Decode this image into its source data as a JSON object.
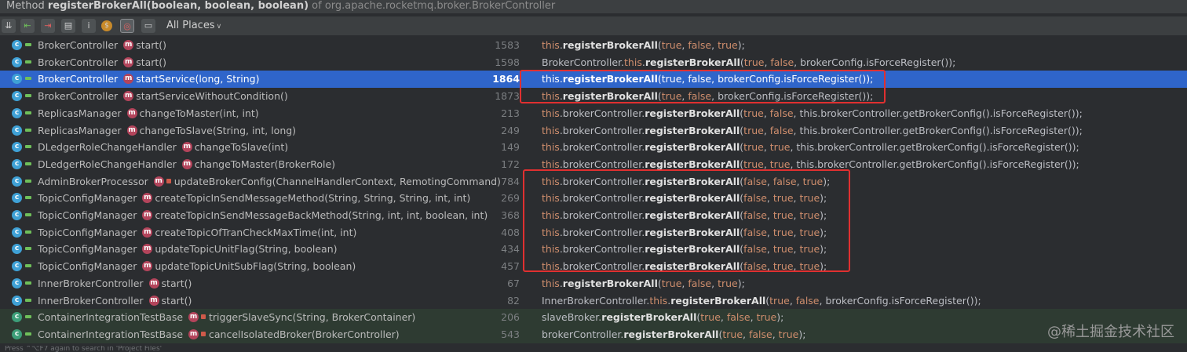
{
  "title": {
    "prefix": "Method ",
    "method": "registerBrokerAll(boolean, boolean, boolean)",
    "of": " of org.apache.rocketmq.broker.BrokerController"
  },
  "toolbar": {
    "scope_label": "All Places",
    "info_label": "i",
    "buttons": [
      "expand-all-icon",
      "navigate-up-icon",
      "navigate-down-icon",
      "group-by-file-icon",
      "info-icon",
      "coin-icon",
      "filter-icon",
      "preview-icon"
    ]
  },
  "rows": [
    {
      "cls": "BrokerController",
      "lock": false,
      "method": "start()",
      "line": "1583",
      "pre": "",
      "tail": "(true, false, true);",
      "style": "this"
    },
    {
      "cls": "BrokerController",
      "lock": false,
      "method": "start()",
      "line": "1598",
      "pre": "BrokerController.",
      "tail": "(true, false, brokerConfig.isForceRegister());",
      "style": "cls-this"
    },
    {
      "cls": "BrokerController",
      "lock": false,
      "method": "startService(long, String)",
      "line": "1864",
      "pre": "",
      "tail": "(true, false, brokerConfig.isForceRegister());",
      "style": "this",
      "selected": true
    },
    {
      "cls": "BrokerController",
      "lock": false,
      "method": "startServiceWithoutCondition()",
      "line": "1873",
      "pre": "",
      "tail": "(true, false, brokerConfig.isForceRegister());",
      "style": "this"
    },
    {
      "cls": "ReplicasManager",
      "lock": false,
      "method": "changeToMaster(int, int)",
      "line": "213",
      "pre": "",
      "tail": "(true, false, this.brokerController.getBrokerConfig().isForceRegister());",
      "style": "bc"
    },
    {
      "cls": "ReplicasManager",
      "lock": false,
      "method": "changeToSlave(String, int, long)",
      "line": "249",
      "pre": "",
      "tail": "(true, false, this.brokerController.getBrokerConfig().isForceRegister());",
      "style": "bc"
    },
    {
      "cls": "DLedgerRoleChangeHandler",
      "lock": false,
      "method": "changeToSlave(int)",
      "line": "149",
      "pre": "",
      "tail": "(true, true, this.brokerController.getBrokerConfig().isForceRegister());",
      "style": "bc"
    },
    {
      "cls": "DLedgerRoleChangeHandler",
      "lock": false,
      "method": "changeToMaster(BrokerRole)",
      "line": "172",
      "pre": "",
      "tail": "(true, true, this.brokerController.getBrokerConfig().isForceRegister());",
      "style": "bc"
    },
    {
      "cls": "AdminBrokerProcessor",
      "lock": true,
      "method": "updateBrokerConfig(ChannelHandlerContext, RemotingCommand)",
      "line": "784",
      "pre": "",
      "tail": "(false, false, true);",
      "style": "bc"
    },
    {
      "cls": "TopicConfigManager",
      "lock": false,
      "method": "createTopicInSendMessageMethod(String, String, String, int, int)",
      "line": "269",
      "pre": "",
      "tail": "(false, true, true);",
      "style": "bc"
    },
    {
      "cls": "TopicConfigManager",
      "lock": false,
      "method": "createTopicInSendMessageBackMethod(String, int, int, boolean, int)",
      "line": "368",
      "pre": "",
      "tail": "(false, true, true);",
      "style": "bc"
    },
    {
      "cls": "TopicConfigManager",
      "lock": false,
      "method": "createTopicOfTranCheckMaxTime(int, int)",
      "line": "408",
      "pre": "",
      "tail": "(false, true, true);",
      "style": "bc"
    },
    {
      "cls": "TopicConfigManager",
      "lock": false,
      "method": "updateTopicUnitFlag(String, boolean)",
      "line": "434",
      "pre": "",
      "tail": "(false, true, true);",
      "style": "bc"
    },
    {
      "cls": "TopicConfigManager",
      "lock": false,
      "method": "updateTopicUnitSubFlag(String, boolean)",
      "line": "457",
      "pre": "",
      "tail": "(false, true, true);",
      "style": "bc"
    },
    {
      "cls": "InnerBrokerController",
      "lock": false,
      "method": "start()",
      "line": "67",
      "pre": "",
      "tail": "(true, false, true);",
      "style": "this"
    },
    {
      "cls": "InnerBrokerController",
      "lock": false,
      "method": "start()",
      "line": "82",
      "pre": "InnerBrokerController.",
      "tail": "(true, false, brokerConfig.isForceRegister());",
      "style": "cls-this"
    },
    {
      "cls": "ContainerIntegrationTestBase",
      "lock": true,
      "method": "triggerSlaveSync(String, BrokerContainer)",
      "line": "206",
      "pre": "slaveBroker.",
      "tail": "(true, false, true);",
      "style": "plain",
      "test": true
    },
    {
      "cls": "ContainerIntegrationTestBase",
      "lock": true,
      "method": "cancelIsolatedBroker(BrokerController)",
      "line": "543",
      "pre": "brokerController.",
      "tail": "(true, false, true);",
      "style": "plain",
      "test": true
    }
  ],
  "tokens": {
    "this": "this",
    "dot": ".",
    "broker_controller": "brokerController",
    "method_name": "registerBrokerAll"
  },
  "status_text": "Press ⌃⌥F7 again to search in 'Project Files'",
  "watermark": "@稀土掘金技术社区",
  "colors": {
    "selection": "#2f65ca",
    "highlight_box": "#e03030",
    "keyword": "#cf8e6d"
  }
}
